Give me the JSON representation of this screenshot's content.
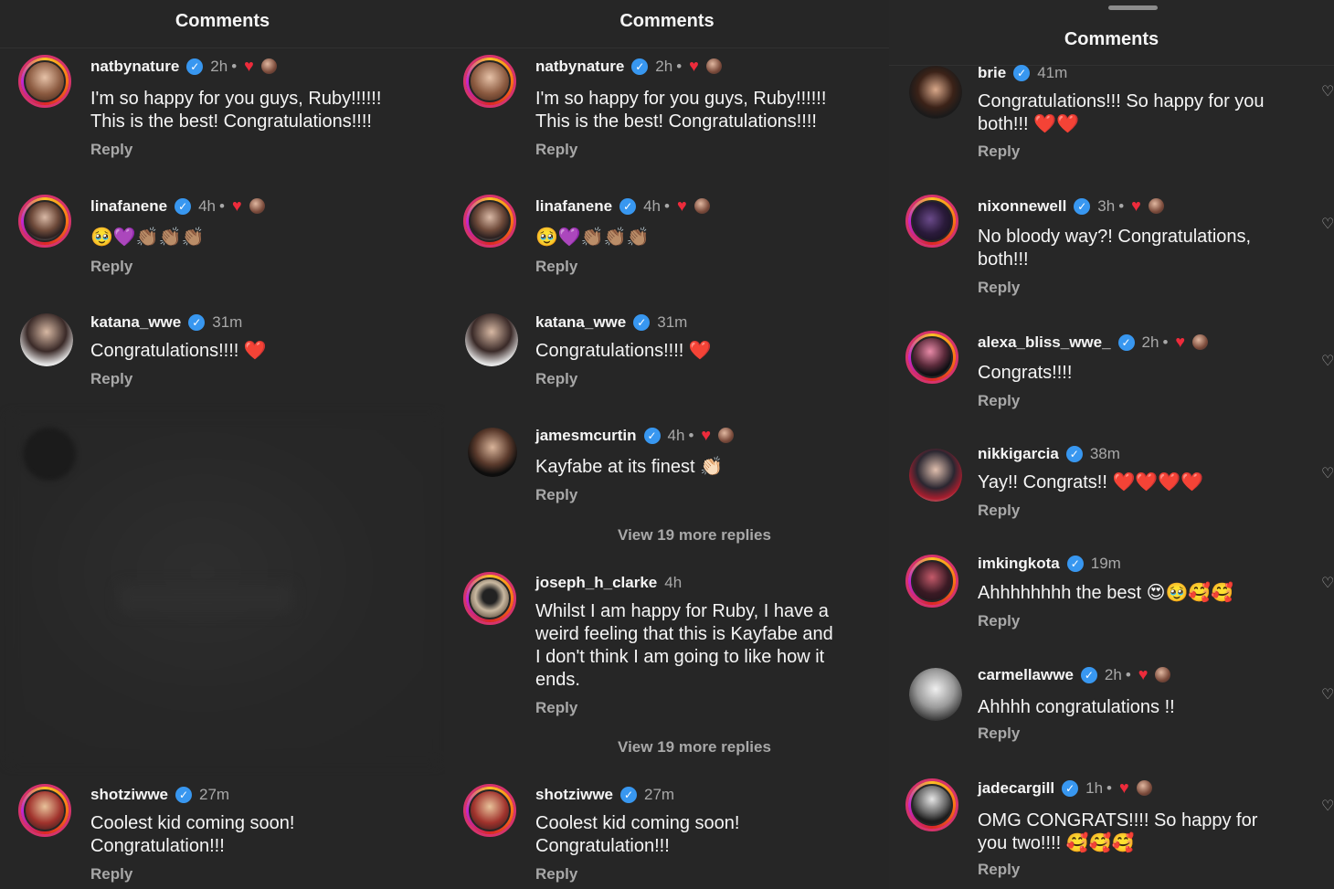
{
  "panels": [
    {
      "title": "Comments",
      "comments": [
        {
          "user": "natbynature",
          "time": "2h",
          "liked_by_author": true,
          "text": "I'm so happy for you guys, Ruby!!!!!!\nThis is the best! Congratulations!!!!",
          "reply": "Reply"
        },
        {
          "user": "linafanene",
          "time": "4h",
          "liked_by_author": true,
          "text": "🥹💜👏🏽👏🏽👏🏽",
          "reply": "Reply"
        },
        {
          "user": "katana_wwe",
          "time": "31m",
          "liked_by_author": false,
          "text": "Congratulations!!!! ❤️",
          "reply": "Reply"
        },
        {
          "user": "shotziwwe",
          "time": "27m",
          "liked_by_author": false,
          "text": "Coolest kid coming soon!\nCongratulation!!!",
          "reply": "Reply"
        }
      ]
    },
    {
      "title": "Comments",
      "comments": [
        {
          "user": "natbynature",
          "time": "2h",
          "liked_by_author": true,
          "text": "I'm so happy for you guys, Ruby!!!!!!\nThis is the best! Congratulations!!!!",
          "reply": "Reply"
        },
        {
          "user": "linafanene",
          "time": "4h",
          "liked_by_author": true,
          "text": "🥹💜👏🏽👏🏽👏🏽",
          "reply": "Reply"
        },
        {
          "user": "katana_wwe",
          "time": "31m",
          "liked_by_author": false,
          "text": "Congratulations!!!! ❤️",
          "reply": "Reply"
        },
        {
          "user": "jamesmcurtin",
          "time": "4h",
          "liked_by_author": true,
          "text": "Kayfabe at its finest 👏🏻",
          "reply": "Reply",
          "view_more": "View 19 more replies"
        },
        {
          "user": "joseph_h_clarke",
          "time": "4h",
          "verified": false,
          "liked_by_author": false,
          "text": "Whilst I am happy for Ruby, I have a\nweird feeling that this is Kayfabe and\nI don't think I am going to like how it\nends.",
          "reply": "Reply",
          "view_more": "View 19 more replies"
        },
        {
          "user": "shotziwwe",
          "time": "27m",
          "liked_by_author": false,
          "text": "Coolest kid coming soon!\nCongratulation!!!",
          "reply": "Reply"
        }
      ]
    },
    {
      "title": "Comments",
      "comments": [
        {
          "user": "brie",
          "time": "41m",
          "liked_by_author": false,
          "text": "Congratulations!!! So happy for you\nboth!!! ❤️❤️",
          "reply": "Reply"
        },
        {
          "user": "nixonnewell",
          "time": "3h",
          "liked_by_author": true,
          "text": "No bloody way?! Congratulations,\nboth!!!",
          "reply": "Reply"
        },
        {
          "user": "alexa_bliss_wwe_",
          "time": "2h",
          "liked_by_author": true,
          "text": "Congrats!!!!",
          "reply": "Reply"
        },
        {
          "user": "nikkigarcia",
          "time": "38m",
          "liked_by_author": false,
          "text": "Yay!! Congrats!! ❤️❤️❤️❤️",
          "reply": "Reply"
        },
        {
          "user": "imkingkota",
          "time": "19m",
          "liked_by_author": false,
          "text": "Ahhhhhhhh the best 😍🥹🥰🥰",
          "reply": "Reply"
        },
        {
          "user": "carmellawwe",
          "time": "2h",
          "liked_by_author": true,
          "text": "Ahhhh congratulations !!",
          "reply": "Reply"
        },
        {
          "user": "jadecargill",
          "time": "1h",
          "liked_by_author": true,
          "text": "OMG CONGRATS!!!! So happy for\nyou two!!!! 🥰🥰🥰",
          "reply": "Reply"
        }
      ]
    }
  ],
  "icons": {
    "verified": "verified-badge-icon",
    "heart": "heart-icon",
    "author_avatar": "author-mini-avatar"
  },
  "colors": {
    "background": "#262626",
    "text": "#f5f5f5",
    "muted": "#a8a8a8",
    "verified": "#3897f0",
    "heart": "#ed2b3b"
  }
}
